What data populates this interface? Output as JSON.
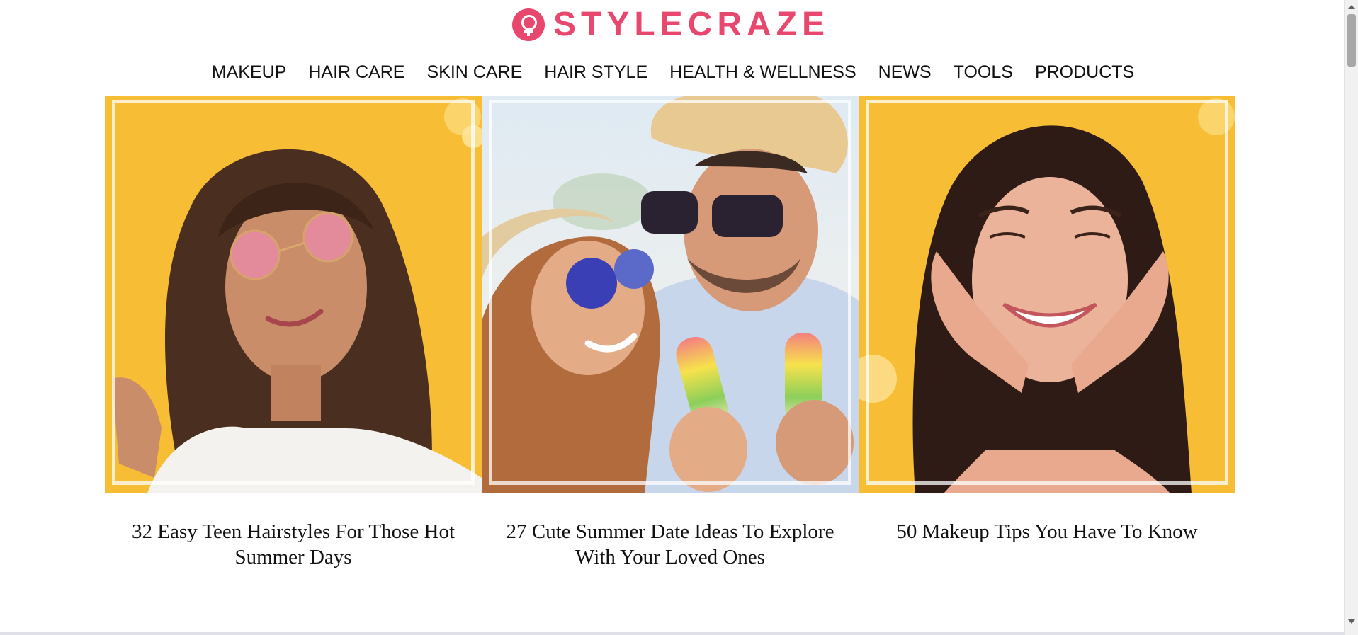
{
  "site": {
    "logo_text": "STYLECRAZE",
    "brand_color": "#e8476e"
  },
  "nav": {
    "items": [
      {
        "label": "MAKEUP"
      },
      {
        "label": "HAIR CARE"
      },
      {
        "label": "SKIN CARE"
      },
      {
        "label": "HAIR STYLE"
      },
      {
        "label": "HEALTH & WELLNESS"
      },
      {
        "label": "NEWS"
      },
      {
        "label": "TOOLS"
      },
      {
        "label": "PRODUCTS"
      }
    ]
  },
  "articles": [
    {
      "title": "32 Easy Teen Hairstyles For Those Hot Summer Days",
      "image_icon": "teen-hairstyle-photo"
    },
    {
      "title": "27 Cute Summer Date Ideas To Explore With Your Loved Ones",
      "image_icon": "summer-date-photo"
    },
    {
      "title": "50 Makeup Tips You Have To Know",
      "image_icon": "makeup-tips-photo"
    }
  ],
  "colors": {
    "photo_background": "#f7be35",
    "text": "#111111"
  }
}
